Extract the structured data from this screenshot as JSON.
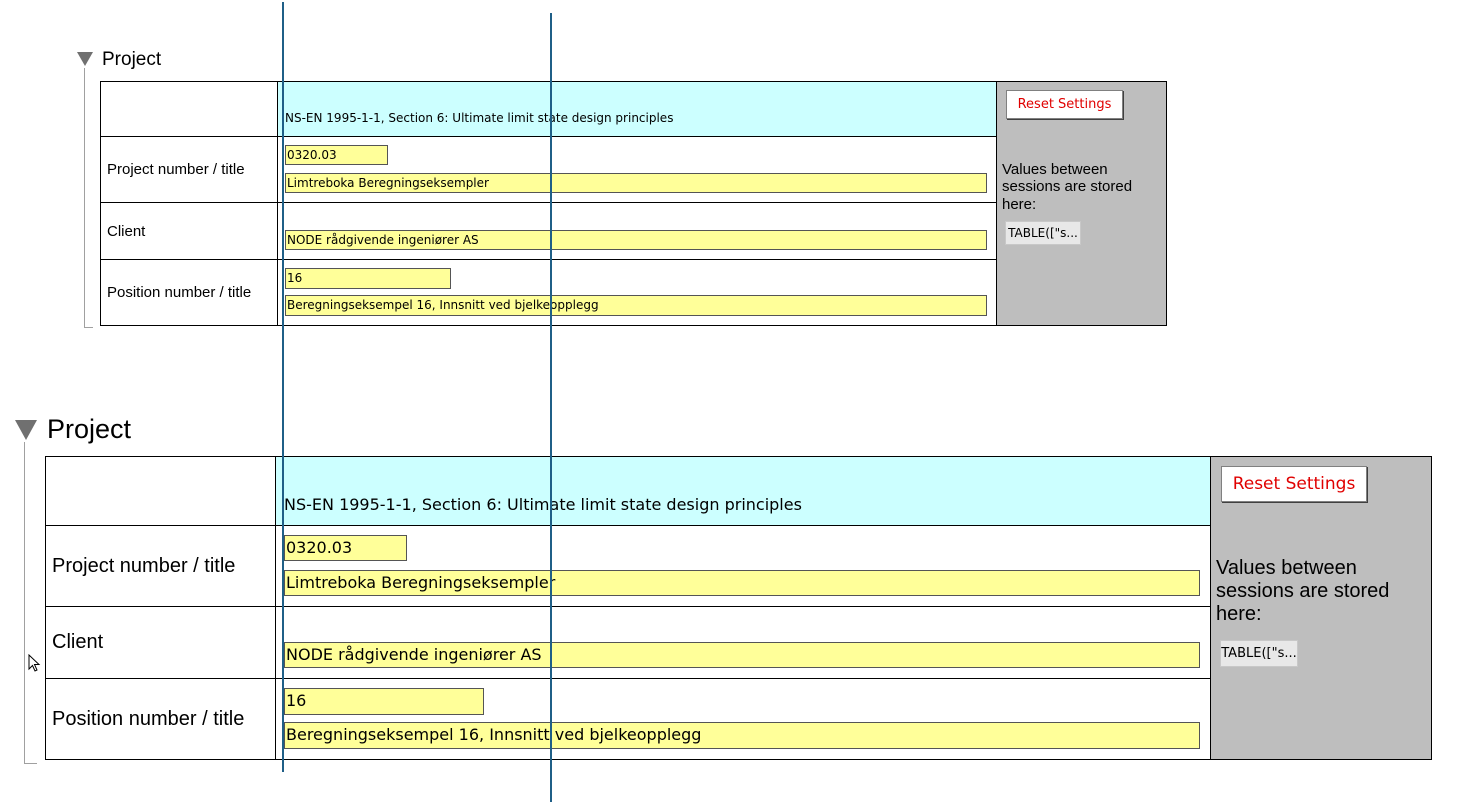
{
  "panels": [
    {
      "section_title": "Project",
      "standard_text": "NS-EN 1995-1-1, Section 6: Ultimate limit state design principles",
      "rows": [
        {
          "label": "Project number / title",
          "fields": [
            "0320.03",
            "Limtreboka Beregningseksempler"
          ]
        },
        {
          "label": "Client",
          "fields": [
            "NODE rådgivende ingeniører AS"
          ]
        },
        {
          "label": "Position number / title",
          "fields": [
            "16",
            "Beregningseksempel 16, Innsnitt ved bjelkeopplegg"
          ]
        }
      ],
      "reset_label": "Reset Settings",
      "note": "Values between sessions are stored here:",
      "table_chip": "TABLE([\"s..."
    },
    {
      "section_title": "Project",
      "standard_text": "NS-EN 1995-1-1, Section 6: Ultimate limit state design principles",
      "rows": [
        {
          "label": "Project number / title",
          "fields": [
            "0320.03",
            "Limtreboka Beregningseksempler"
          ]
        },
        {
          "label": "Client",
          "fields": [
            "NODE rådgivende ingeniører AS"
          ]
        },
        {
          "label": "Position number / title",
          "fields": [
            "16",
            "Beregningseksempel 16, Innsnitt ved bjelkeopplegg"
          ]
        }
      ],
      "reset_label": "Reset Settings",
      "note": "Values between sessions are stored here:",
      "table_chip": "TABLE([\"s..."
    }
  ],
  "icons": {
    "collapse": "triangle-down-icon",
    "cursor": "mouse-pointer-icon"
  },
  "colors": {
    "input_bg": "#ffff99",
    "standard_bg": "#ccffff",
    "side_panel_bg": "#bebebe",
    "reset_text": "#e00000",
    "guide_line": "#1f5f87"
  }
}
